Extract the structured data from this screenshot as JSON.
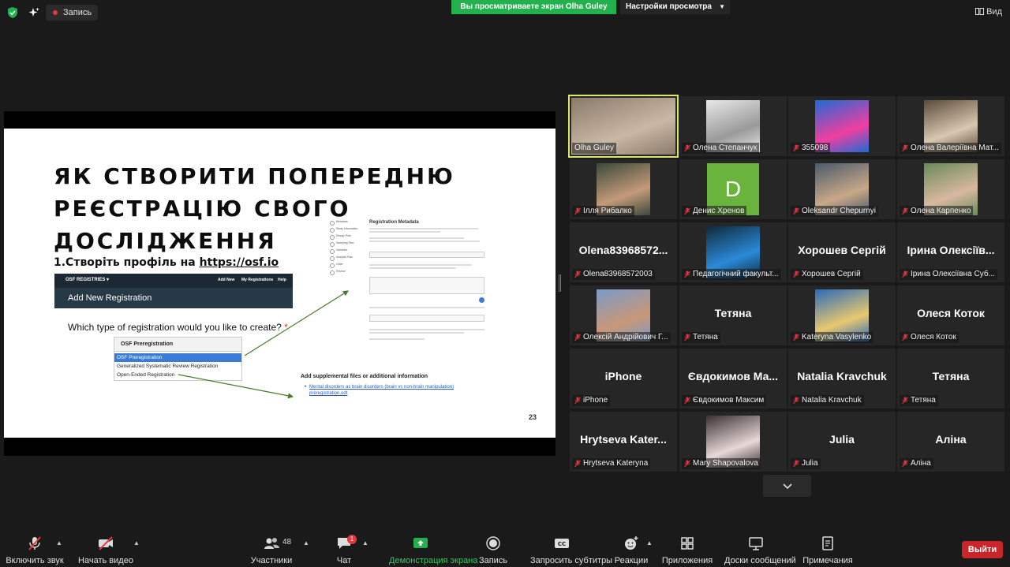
{
  "topbar": {
    "record_label": "Запись",
    "share_banner": "Вы просматриваете экран Olha Guley",
    "view_settings": "Настройки просмотра",
    "view_label": "Вид"
  },
  "slide": {
    "title": "ЯК СТВОРИТИ ПОПЕРЕДНЮ РЕЄСТРАЦІЮ СВОГО ДОСЛІДЖЕННЯ",
    "step_prefix": "1.Створіть профіль на ",
    "step_link": "https://osf.io",
    "osf_logo": "OSF REGISTRIES ▾",
    "osf_nav": [
      "Add New",
      "My Registrations",
      "Help"
    ],
    "osf_add_title": "Add New Registration",
    "question": "Which type of registration would you like to create?",
    "question_star": "*",
    "dropdown_header": "OSF Preregistration",
    "dropdown_options": [
      "OSF Preregistration",
      "Generalized Systematic Review Registration",
      "Open-Ended Registration"
    ],
    "meta_title": "Registration Metadata",
    "meta_sidebar": [
      "Metadata",
      "Study Information",
      "Design Plan",
      "Sampling Plan",
      "Variables",
      "Analysis Plan",
      "Other",
      "Review"
    ],
    "supp_title": "Add supplemental files or additional information",
    "supp_link": "Mental disorders as brain disorders (brain vs non-brain manipulation) preregistration.odt",
    "page_number": "23"
  },
  "participants": [
    {
      "name": "Olha Guley",
      "big": "",
      "muted": false,
      "active": true,
      "video": "photo"
    },
    {
      "name": "Олена Степанчук",
      "big": "",
      "muted": true,
      "video": "photo"
    },
    {
      "name": "355098",
      "big": "",
      "muted": true,
      "video": "photo"
    },
    {
      "name": "Олена Валеріївна Мат...",
      "big": "",
      "muted": true,
      "video": "photo"
    },
    {
      "name": "Ілля Рибалко",
      "big": "",
      "muted": true,
      "video": "photo"
    },
    {
      "name": "Денис Хренов",
      "big": "D",
      "muted": true,
      "video": "avatar"
    },
    {
      "name": "Oleksandr Chepurnyi",
      "big": "",
      "muted": true,
      "video": "photo"
    },
    {
      "name": "Олена Карпенко",
      "big": "",
      "muted": true,
      "video": "photo"
    },
    {
      "name": "Olena83968572003",
      "big": "Olena83968572...",
      "muted": true,
      "video": "none"
    },
    {
      "name": "Педагогічний факульт...",
      "big": "",
      "muted": true,
      "video": "photo"
    },
    {
      "name": "Хорошев Сергій",
      "big": "Хорошев Сергій",
      "muted": true,
      "video": "none"
    },
    {
      "name": "Ірина Олексіївна Суб...",
      "big": "Ірина Олексіїв...",
      "muted": true,
      "video": "none"
    },
    {
      "name": "Олексій Андрійович Г...",
      "big": "",
      "muted": true,
      "video": "photo"
    },
    {
      "name": "Тетяна",
      "big": "Тетяна",
      "muted": true,
      "video": "none"
    },
    {
      "name": "Kateryna Vasylenko",
      "big": "",
      "muted": true,
      "video": "photo"
    },
    {
      "name": "Олеся Коток",
      "big": "Олеся Коток",
      "muted": true,
      "video": "none"
    },
    {
      "name": "iPhone",
      "big": "iPhone",
      "muted": true,
      "video": "none"
    },
    {
      "name": "Євдокимов Максим",
      "big": "Євдокимов Ма...",
      "muted": true,
      "video": "none"
    },
    {
      "name": "Natalia Kravchuk",
      "big": "Natalia Kravchuk",
      "muted": true,
      "video": "none"
    },
    {
      "name": "Тетяна",
      "big": "Тетяна",
      "muted": true,
      "video": "none"
    },
    {
      "name": "Hrytseva Kateryna",
      "big": "Hrytseva Kater...",
      "muted": true,
      "video": "none"
    },
    {
      "name": "Mary Shapovalova",
      "big": "",
      "muted": true,
      "video": "photo"
    },
    {
      "name": "Julia",
      "big": "Julia",
      "muted": true,
      "video": "none"
    },
    {
      "name": "Аліна",
      "big": "Аліна",
      "muted": true,
      "video": "none"
    }
  ],
  "toolbar": {
    "audio": "Включить звук",
    "video": "Начать видео",
    "participants": "Участники",
    "participants_count": "48",
    "chat": "Чат",
    "chat_badge": "1",
    "share": "Демонстрация экрана",
    "record": "Запись",
    "captions": "Запросить субтитры",
    "reactions": "Реакции",
    "apps": "Приложения",
    "whiteboards": "Доски сообщений",
    "notes": "Примечания",
    "exit": "Выйти"
  },
  "colors": {
    "banner_green": "#23b14d",
    "exit_red": "#c8262b",
    "active_outline": "#d9e86b",
    "share_label_green": "#3ec25f"
  }
}
